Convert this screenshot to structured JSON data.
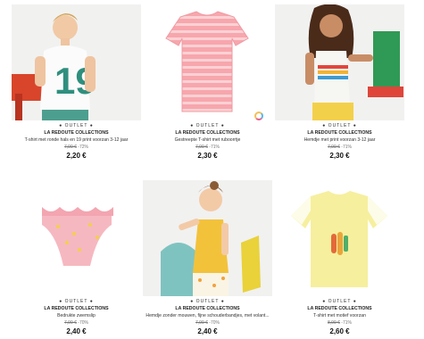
{
  "products": [
    {
      "badge": "● OUTLET ●",
      "brand": "LA REDOUTE COLLECTIONS",
      "name": "T-shirt met ronde hals en 19 print voorzan 3-12 jaar",
      "old_price": "7,99 €",
      "discount": "-72%",
      "price": "2,20 €"
    },
    {
      "badge": "● OUTLET ●",
      "brand": "LA REDOUTE COLLECTIONS",
      "name": "Gestreepte T-shirt met ruboorrtje",
      "old_price": "7,99 €",
      "discount": "-71%",
      "price": "2,30 €"
    },
    {
      "badge": "● OUTLET ●",
      "brand": "LA REDOUTE COLLECTIONS",
      "name": "Hemdje met print voorzan 3-12 jaar",
      "old_price": "7,99 €",
      "discount": "-71%",
      "price": "2,30 €"
    },
    {
      "badge": "● OUTLET ●",
      "brand": "LA REDOUTE COLLECTIONS",
      "name": "Bedrukte zwemslip",
      "old_price": "7,99 €",
      "discount": "-70%",
      "price": "2,40 €"
    },
    {
      "badge": "● OUTLET ●",
      "brand": "LA REDOUTE COLLECTIONS",
      "name": "Hemdje zonder mouwen, fijne schouderbandjes, met volant...",
      "old_price": "7,99 €",
      "discount": "-70%",
      "price": "2,40 €"
    },
    {
      "badge": "● OUTLET ●",
      "brand": "LA REDOUTE COLLECTIONS",
      "name": "T-shirt met motief voorzan",
      "old_price": "8,99 €",
      "discount": "-71%",
      "price": "2,60 €"
    }
  ],
  "icons": {
    "loading": "loading-spinner-icon"
  }
}
